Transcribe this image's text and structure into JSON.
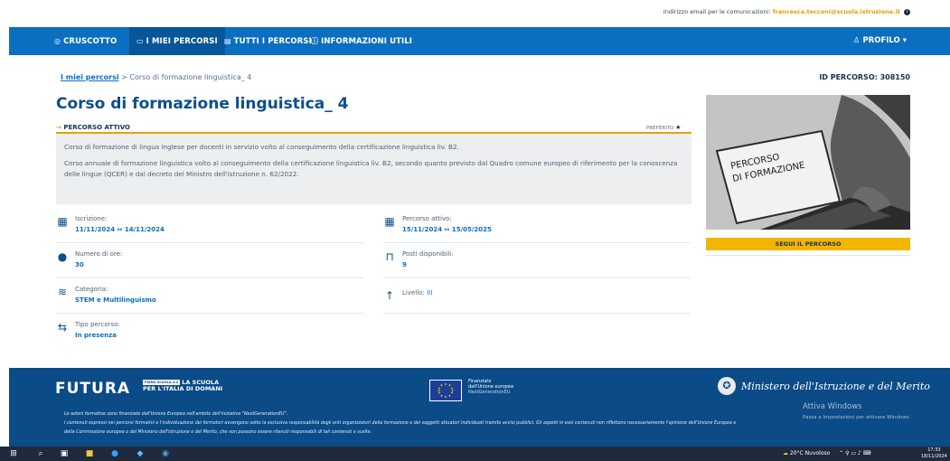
{
  "topbar": {
    "email_label": "Indirizzo email per le comunicazioni:",
    "email_value": "francesca.tecconi@scuola.istruzione.it"
  },
  "nav": {
    "items": [
      {
        "label": "CRUSCOTTO",
        "icon": "dashboard-icon"
      },
      {
        "label": "I MIEI PERCORSI",
        "icon": "monitor-icon"
      },
      {
        "label": "TUTTI I PERCORSI",
        "icon": "list-icon"
      },
      {
        "label": "INFORMAZIONI UTILI",
        "icon": "help-icon"
      }
    ],
    "profile": "PROFILO"
  },
  "breadcrumb": {
    "link": "I miei percorsi",
    "separator": ">",
    "current": "Corso di formazione linguistica_ 4"
  },
  "course_id": "ID PERCORSO: 308150",
  "course": {
    "title": "Corso di formazione linguistica_ 4",
    "status": "PERCORSO ATTIVO",
    "favourite": "PREFERITO",
    "description_1": "Corso di formazione di lingua inglese per docenti in servizio volto al conseguimento della certificazione linguistica liv. B2.",
    "description_2": "Corso annuale di formazione linguistica volto al conseguimento della certificazione linguistica liv. B2, secondo quanto previsto dal Quadro comune europeo di riferimento per la conoscenza delle lingue (QCER) e dal decreto del Ministro dell'istruzione n. 62/2022."
  },
  "fields": {
    "iscrizione": {
      "label": "Iscrizione:",
      "value": "11/11/2024 ↔ 14/11/2024"
    },
    "percorso_attivo": {
      "label": "Percorso attivo:",
      "value": "15/11/2024 ↔ 15/05/2025"
    },
    "numero_ore": {
      "label": "Numero di ore:",
      "value": "30"
    },
    "posti": {
      "label": "Posti disponibili:",
      "value": "9"
    },
    "categoria": {
      "label": "Categoria:",
      "value": "STEM e Multilinguismo"
    },
    "livello": {
      "label": "Livello:",
      "value": "III"
    },
    "tipo": {
      "label": "Tipo percorso:",
      "value": "In presenza"
    }
  },
  "hero": {
    "line1": "PERCORSO",
    "line2": "DI FORMAZIONE"
  },
  "cta": "SEGUI IL PERCORSO",
  "footer": {
    "futura": "FUTURA",
    "futura_badge": "PIANO SCUOLA 4.0",
    "futura_sub1": "LA SCUOLA",
    "futura_sub2": "PER L'ITALIA DI DOMANI",
    "eu_line1": "Finanziato",
    "eu_line2": "dall'Unione europea",
    "eu_line3": "NextGenerationEU",
    "ministero": "Ministero dell'Istruzione e del Merito",
    "legal_1": "Le azioni formative sono finanziate dall'Unione Europea nell'ambito dell'iniziativa \"NextGenerationEU\".",
    "legal_2": "I contenuti espressi nei percorsi formativi e l'individuazione dei formatori avvengono sotto la esclusiva responsabilità degli enti organizzatori della formazione e dei soggetti attuatori individuati tramite avvisi pubblici. Gli aspetti in essi contenuti non riflettono necessariamente l'opinione dell'Unione Europea o",
    "legal_3": "della Commissione europea o del Ministero dell'Istruzione e del Merito, che non possono essere ritenuti responsabili di tali contenuti e scelte.",
    "activate": "Attiva Windows",
    "activate_sub": "Passa a Impostazioni per attivare Windows."
  },
  "taskbar": {
    "weather": "20°C Nuvoloso",
    "time": "17:33",
    "date": "18/11/2024"
  }
}
